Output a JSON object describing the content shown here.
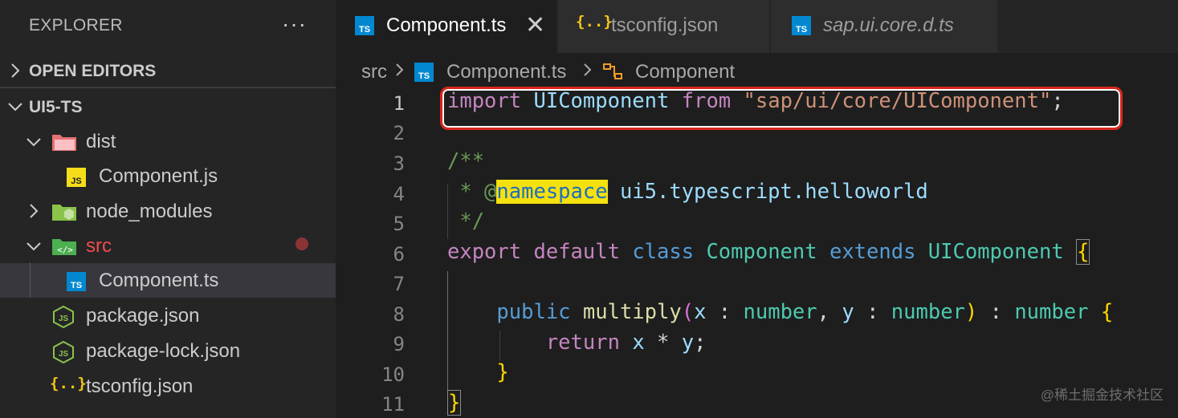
{
  "explorer": {
    "title": "EXPLORER",
    "more_label": "···",
    "sections": {
      "open_editors": "OPEN EDITORS",
      "project": "UI5-TS"
    },
    "tree": [
      {
        "name": "dist",
        "icon": "folder-dist-icon"
      },
      {
        "name": "Component.js",
        "icon": "js-file-icon"
      },
      {
        "name": "node_modules",
        "icon": "folder-node-icon"
      },
      {
        "name": "src",
        "icon": "folder-src-icon",
        "color": "#f14c4c"
      },
      {
        "name": "Component.ts",
        "icon": "ts-file-icon"
      },
      {
        "name": "package.json",
        "icon": "nodejs-icon"
      },
      {
        "name": "package-lock.json",
        "icon": "nodejs-icon"
      },
      {
        "name": "tsconfig.json",
        "icon": "json-braces-icon"
      }
    ]
  },
  "tabs": [
    {
      "label": "Component.ts",
      "icon": "ts-file-icon",
      "close": "✕"
    },
    {
      "label": "tsconfig.json",
      "icon": "json-braces-icon"
    },
    {
      "label": "sap.ui.core.d.ts",
      "icon": "ts-file-icon"
    }
  ],
  "breadcrumb": {
    "folder": "src",
    "file": "Component.ts",
    "symbol": "Component"
  },
  "icon_text": {
    "ts": "TS",
    "js": "JS",
    "braces": "{..}",
    "node": "JS"
  },
  "code": {
    "line_numbers": [
      "1",
      "2",
      "3",
      "4",
      "5",
      "6",
      "7",
      "8",
      "9",
      "10",
      "11"
    ],
    "l1": {
      "import": "import",
      "name": "UIComponent",
      "from": "from",
      "path": "\"sap/ui/core/UIComponent\"",
      "semi": ";"
    },
    "l3": "/**",
    "l4": {
      "star": " * @",
      "tag": "namespace",
      "ns": " ui5.typescript.helloworld"
    },
    "l5": " */",
    "l6": {
      "export": "export",
      "default": "default",
      "class": "class",
      "name": "Component",
      "extends": "extends",
      "base": "UIComponent",
      "brace": "{"
    },
    "l8": {
      "public": "public",
      "method": "multiply",
      "open": "(",
      "x": "x",
      "colon1": " : ",
      "num1": "number",
      "comma": ", ",
      "y": "y",
      "colon2": " : ",
      "num2": "number",
      "close": ")",
      "colon3": " : ",
      "num3": "number",
      "brace": "{"
    },
    "l9": {
      "ret": "return",
      "x": "x",
      "op": " * ",
      "y": "y",
      "semi": ";"
    },
    "l10": "}",
    "l11": "}"
  },
  "watermark": "@稀土掘金技术社区",
  "colors": {
    "accent_red": "#d9261c",
    "highlight": "#f5e10d"
  }
}
